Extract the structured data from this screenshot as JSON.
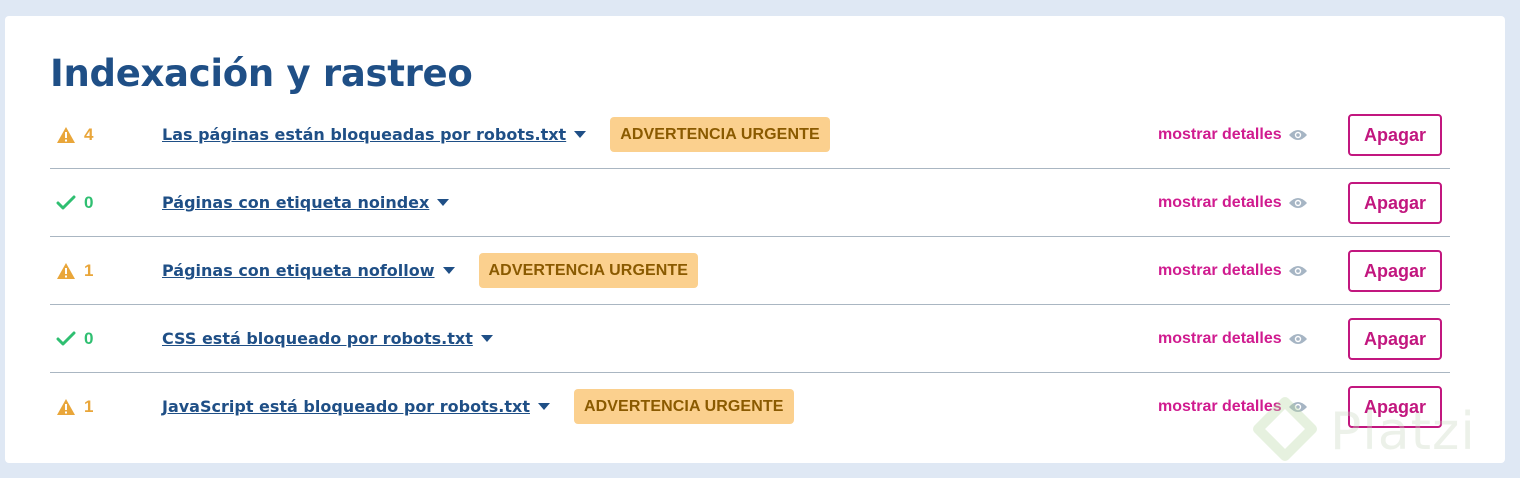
{
  "page": {
    "title": "Indexación y rastreo"
  },
  "rows": [
    {
      "status": "warning",
      "count": "4",
      "label": "Las páginas están bloqueadas por robots.txt",
      "badge": "ADVERTENCIA URGENTE",
      "details": "mostrar detalles",
      "button": "Apagar"
    },
    {
      "status": "ok",
      "count": "0",
      "label": "Páginas con etiqueta noindex",
      "badge": "",
      "details": "mostrar detalles",
      "button": "Apagar"
    },
    {
      "status": "warning",
      "count": "1",
      "label": "Páginas con etiqueta nofollow",
      "badge": "ADVERTENCIA URGENTE",
      "details": "mostrar detalles",
      "button": "Apagar"
    },
    {
      "status": "ok",
      "count": "0",
      "label": "CSS está bloqueado por robots.txt",
      "badge": "",
      "details": "mostrar detalles",
      "button": "Apagar"
    },
    {
      "status": "warning",
      "count": "1",
      "label": "JavaScript está bloqueado por robots.txt",
      "badge": "ADVERTENCIA URGENTE",
      "details": "mostrar detalles",
      "button": "Apagar"
    }
  ],
  "icons": {
    "warning": "warning-triangle-icon",
    "ok": "checkmark-icon",
    "details": "eye-icon",
    "dropdown": "caret-down-icon"
  },
  "colors": {
    "title": "#1f4f86",
    "warning": "#e9a63a",
    "ok": "#2fbf71",
    "badge_bg": "#fbd08e",
    "badge_text": "#8a5a00",
    "accent": "#c2177f"
  },
  "watermark": {
    "text": "Platzi"
  }
}
